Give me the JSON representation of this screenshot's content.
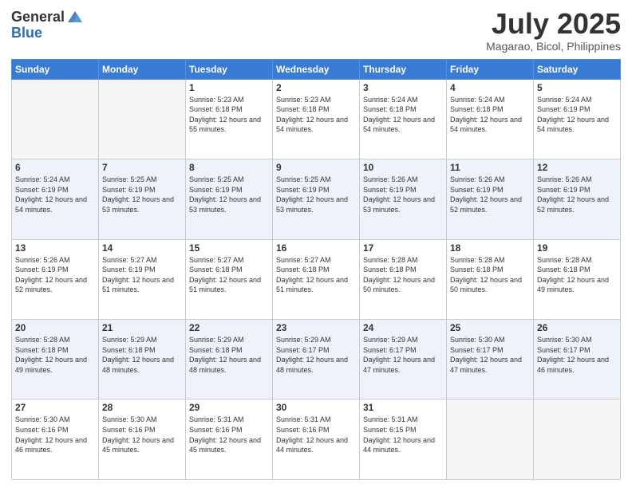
{
  "logo": {
    "general": "General",
    "blue": "Blue"
  },
  "title": "July 2025",
  "subtitle": "Magarao, Bicol, Philippines",
  "days_of_week": [
    "Sunday",
    "Monday",
    "Tuesday",
    "Wednesday",
    "Thursday",
    "Friday",
    "Saturday"
  ],
  "weeks": [
    [
      {
        "day": "",
        "sunrise": "",
        "sunset": "",
        "daylight": ""
      },
      {
        "day": "",
        "sunrise": "",
        "sunset": "",
        "daylight": ""
      },
      {
        "day": "1",
        "sunrise": "Sunrise: 5:23 AM",
        "sunset": "Sunset: 6:18 PM",
        "daylight": "Daylight: 12 hours and 55 minutes."
      },
      {
        "day": "2",
        "sunrise": "Sunrise: 5:23 AM",
        "sunset": "Sunset: 6:18 PM",
        "daylight": "Daylight: 12 hours and 54 minutes."
      },
      {
        "day": "3",
        "sunrise": "Sunrise: 5:24 AM",
        "sunset": "Sunset: 6:18 PM",
        "daylight": "Daylight: 12 hours and 54 minutes."
      },
      {
        "day": "4",
        "sunrise": "Sunrise: 5:24 AM",
        "sunset": "Sunset: 6:18 PM",
        "daylight": "Daylight: 12 hours and 54 minutes."
      },
      {
        "day": "5",
        "sunrise": "Sunrise: 5:24 AM",
        "sunset": "Sunset: 6:19 PM",
        "daylight": "Daylight: 12 hours and 54 minutes."
      }
    ],
    [
      {
        "day": "6",
        "sunrise": "Sunrise: 5:24 AM",
        "sunset": "Sunset: 6:19 PM",
        "daylight": "Daylight: 12 hours and 54 minutes."
      },
      {
        "day": "7",
        "sunrise": "Sunrise: 5:25 AM",
        "sunset": "Sunset: 6:19 PM",
        "daylight": "Daylight: 12 hours and 53 minutes."
      },
      {
        "day": "8",
        "sunrise": "Sunrise: 5:25 AM",
        "sunset": "Sunset: 6:19 PM",
        "daylight": "Daylight: 12 hours and 53 minutes."
      },
      {
        "day": "9",
        "sunrise": "Sunrise: 5:25 AM",
        "sunset": "Sunset: 6:19 PM",
        "daylight": "Daylight: 12 hours and 53 minutes."
      },
      {
        "day": "10",
        "sunrise": "Sunrise: 5:26 AM",
        "sunset": "Sunset: 6:19 PM",
        "daylight": "Daylight: 12 hours and 53 minutes."
      },
      {
        "day": "11",
        "sunrise": "Sunrise: 5:26 AM",
        "sunset": "Sunset: 6:19 PM",
        "daylight": "Daylight: 12 hours and 52 minutes."
      },
      {
        "day": "12",
        "sunrise": "Sunrise: 5:26 AM",
        "sunset": "Sunset: 6:19 PM",
        "daylight": "Daylight: 12 hours and 52 minutes."
      }
    ],
    [
      {
        "day": "13",
        "sunrise": "Sunrise: 5:26 AM",
        "sunset": "Sunset: 6:19 PM",
        "daylight": "Daylight: 12 hours and 52 minutes."
      },
      {
        "day": "14",
        "sunrise": "Sunrise: 5:27 AM",
        "sunset": "Sunset: 6:19 PM",
        "daylight": "Daylight: 12 hours and 51 minutes."
      },
      {
        "day": "15",
        "sunrise": "Sunrise: 5:27 AM",
        "sunset": "Sunset: 6:18 PM",
        "daylight": "Daylight: 12 hours and 51 minutes."
      },
      {
        "day": "16",
        "sunrise": "Sunrise: 5:27 AM",
        "sunset": "Sunset: 6:18 PM",
        "daylight": "Daylight: 12 hours and 51 minutes."
      },
      {
        "day": "17",
        "sunrise": "Sunrise: 5:28 AM",
        "sunset": "Sunset: 6:18 PM",
        "daylight": "Daylight: 12 hours and 50 minutes."
      },
      {
        "day": "18",
        "sunrise": "Sunrise: 5:28 AM",
        "sunset": "Sunset: 6:18 PM",
        "daylight": "Daylight: 12 hours and 50 minutes."
      },
      {
        "day": "19",
        "sunrise": "Sunrise: 5:28 AM",
        "sunset": "Sunset: 6:18 PM",
        "daylight": "Daylight: 12 hours and 49 minutes."
      }
    ],
    [
      {
        "day": "20",
        "sunrise": "Sunrise: 5:28 AM",
        "sunset": "Sunset: 6:18 PM",
        "daylight": "Daylight: 12 hours and 49 minutes."
      },
      {
        "day": "21",
        "sunrise": "Sunrise: 5:29 AM",
        "sunset": "Sunset: 6:18 PM",
        "daylight": "Daylight: 12 hours and 48 minutes."
      },
      {
        "day": "22",
        "sunrise": "Sunrise: 5:29 AM",
        "sunset": "Sunset: 6:18 PM",
        "daylight": "Daylight: 12 hours and 48 minutes."
      },
      {
        "day": "23",
        "sunrise": "Sunrise: 5:29 AM",
        "sunset": "Sunset: 6:17 PM",
        "daylight": "Daylight: 12 hours and 48 minutes."
      },
      {
        "day": "24",
        "sunrise": "Sunrise: 5:29 AM",
        "sunset": "Sunset: 6:17 PM",
        "daylight": "Daylight: 12 hours and 47 minutes."
      },
      {
        "day": "25",
        "sunrise": "Sunrise: 5:30 AM",
        "sunset": "Sunset: 6:17 PM",
        "daylight": "Daylight: 12 hours and 47 minutes."
      },
      {
        "day": "26",
        "sunrise": "Sunrise: 5:30 AM",
        "sunset": "Sunset: 6:17 PM",
        "daylight": "Daylight: 12 hours and 46 minutes."
      }
    ],
    [
      {
        "day": "27",
        "sunrise": "Sunrise: 5:30 AM",
        "sunset": "Sunset: 6:16 PM",
        "daylight": "Daylight: 12 hours and 46 minutes."
      },
      {
        "day": "28",
        "sunrise": "Sunrise: 5:30 AM",
        "sunset": "Sunset: 6:16 PM",
        "daylight": "Daylight: 12 hours and 45 minutes."
      },
      {
        "day": "29",
        "sunrise": "Sunrise: 5:31 AM",
        "sunset": "Sunset: 6:16 PM",
        "daylight": "Daylight: 12 hours and 45 minutes."
      },
      {
        "day": "30",
        "sunrise": "Sunrise: 5:31 AM",
        "sunset": "Sunset: 6:16 PM",
        "daylight": "Daylight: 12 hours and 44 minutes."
      },
      {
        "day": "31",
        "sunrise": "Sunrise: 5:31 AM",
        "sunset": "Sunset: 6:15 PM",
        "daylight": "Daylight: 12 hours and 44 minutes."
      },
      {
        "day": "",
        "sunrise": "",
        "sunset": "",
        "daylight": ""
      },
      {
        "day": "",
        "sunrise": "",
        "sunset": "",
        "daylight": ""
      }
    ]
  ]
}
